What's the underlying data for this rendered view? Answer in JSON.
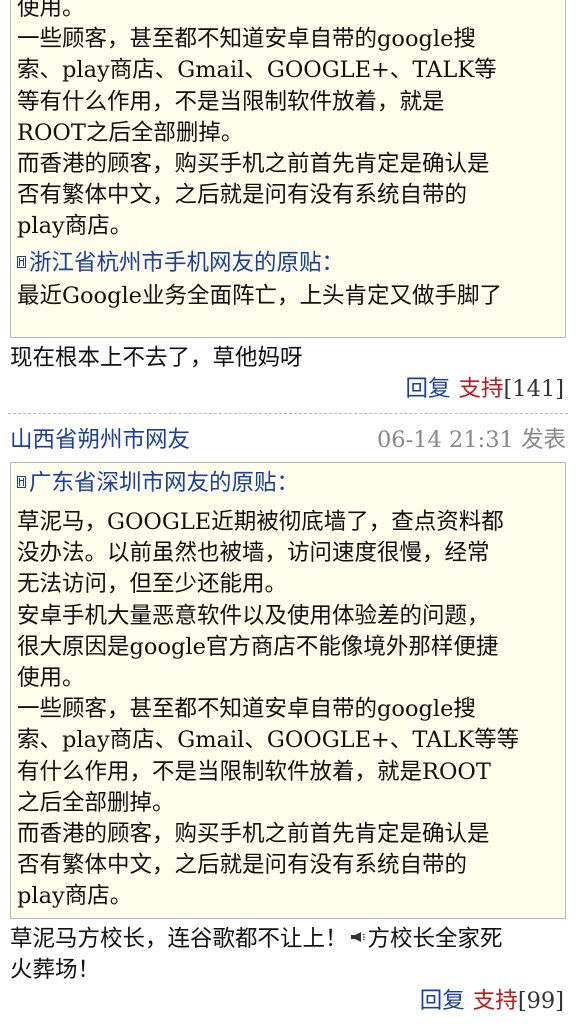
{
  "post1": {
    "quote_top_lines": [
      "使用。",
      "一些顾客，甚至都不知道安卓自带的google搜",
      "索、play商店、Gmail、GOOGLE+、TALK等",
      "等有什么作用，不是当限制软件放着，就是",
      "ROOT之后全部删掉。",
      "而香港的顾客，购买手机之前首先肯定是确认是",
      "否有繁体中文，之后就是问有没有系统自带的",
      "play商店。"
    ],
    "inner_quote_link": "浙江省杭州市手机网友的原贴：",
    "inner_quote_lines": [
      "最近Google业务全面阵亡，上头肯定又做手脚了"
    ],
    "body_lines": [
      "现在根本上不去了，草他妈呀"
    ],
    "reply_label": "回复",
    "support_label": "支持",
    "support_count": "[141]"
  },
  "post2": {
    "author": "山西省朔州市网友",
    "time": "06-14 21:31 发表",
    "quote_link": "广东省深圳市网友的原贴：",
    "quote_lines": [
      "草泥马，GOOGLE近期被彻底墙了，查点资料都",
      "没办法。以前虽然也被墙，访问速度很慢，经常",
      "无法访问，但至少还能用。",
      "安卓手机大量恶意软件以及使用体验差的问题，",
      "很大原因是google官方商店不能像境外那样便捷",
      "使用。",
      "一些顾客，甚至都不知道安卓自带的google搜",
      "索、play商店、Gmail、GOOGLE+、TALK等等",
      "有什么作用，不是当限制软件放着，就是ROOT",
      "之后全部删掉。",
      "而香港的顾客，购买手机之前首先肯定是确认是",
      "否有繁体中文，之后就是问有没有系统自带的",
      "play商店。"
    ],
    "body_line1_a": "草泥马方校长，连谷歌都不让上！",
    "body_line1_b": "方校长全家死",
    "body_line2": "火葬场！",
    "reply_label": "回复",
    "support_label": "支持",
    "support_count": "[99]"
  },
  "colors": {
    "link": "#1a3fa0",
    "support": "#c8161d",
    "quote_bg": "#fffdeb"
  },
  "icons": [
    "quote-icon",
    "speaker-emoji-icon"
  ]
}
